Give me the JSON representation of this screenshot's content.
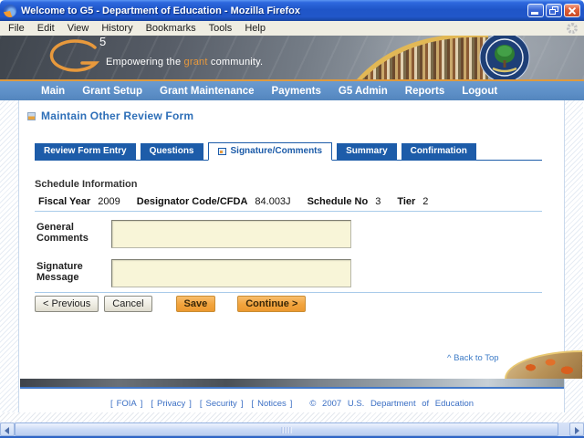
{
  "window": {
    "title": "Welcome to G5 - Department of Education - Mozilla Firefox"
  },
  "menubar": {
    "items": [
      "File",
      "Edit",
      "View",
      "History",
      "Bookmarks",
      "Tools",
      "Help"
    ]
  },
  "header": {
    "logo_letter": "G",
    "logo_number": "5",
    "tagline_pre": "Empowering the ",
    "tagline_accent": "grant",
    "tagline_post": " community."
  },
  "navbar": {
    "items": [
      "Main",
      "Grant Setup",
      "Grant Maintenance",
      "Payments",
      "G5 Admin",
      "Reports",
      "Logout"
    ]
  },
  "page": {
    "title": "Maintain Other Review Form",
    "tabs": [
      {
        "label": "Review Form Entry",
        "active": false
      },
      {
        "label": "Questions",
        "active": false
      },
      {
        "label": "Signature/Comments",
        "active": true
      },
      {
        "label": "Summary",
        "active": false
      },
      {
        "label": "Confirmation",
        "active": false
      }
    ],
    "section_title": "Schedule Information",
    "schedule": [
      {
        "label": "Fiscal Year",
        "value": "2009"
      },
      {
        "label": "Designator Code/CFDA",
        "value": "84.003J"
      },
      {
        "label": "Schedule No",
        "value": "3"
      },
      {
        "label": "Tier",
        "value": "2"
      }
    ],
    "fields": [
      {
        "label": "General Comments",
        "value": ""
      },
      {
        "label": "Signature Message",
        "value": ""
      }
    ],
    "buttons": {
      "previous": "< Previous",
      "cancel": "Cancel",
      "save": "Save",
      "continue": "Continue >"
    },
    "back_to_top": "^ Back to Top"
  },
  "footer": {
    "bracket_open": "[",
    "bracket_close": "]",
    "links": [
      "FOIA",
      "Privacy",
      "Security",
      "Notices"
    ],
    "copyright": "© 2007 U.S. Department of Education"
  },
  "colors": {
    "accent_orange": "#E8993C",
    "nav_blue": "#5D8FC7",
    "tab_blue": "#1D5CA9",
    "link_blue": "#3B6FC4",
    "textarea_cream": "#F8F5D8",
    "rule_light_blue": "#A9CBEA"
  }
}
